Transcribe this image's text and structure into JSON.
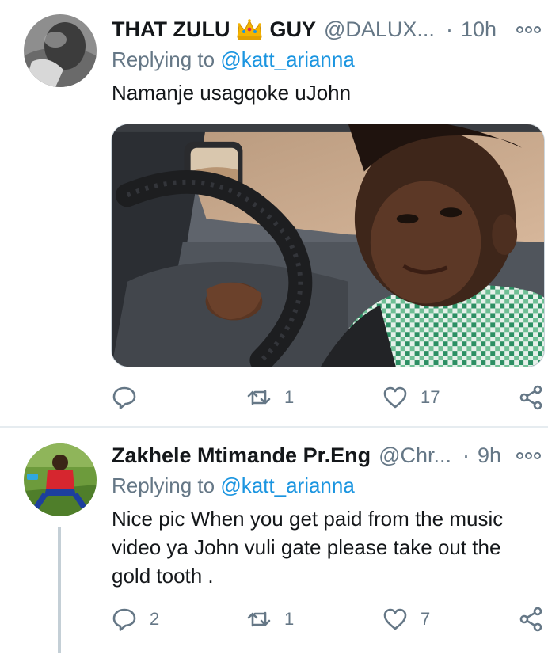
{
  "tweets": [
    {
      "name_part1": "THAT ZULU",
      "name_part2": "GUY",
      "name_emoji": "crown-icon",
      "handle": "@DALUX...",
      "dot": "·",
      "time": "10h",
      "replying_prefix": "Replying to",
      "replying_to": "@katt_arianna",
      "text": "Namanje usagqoke uJohn",
      "has_media": true,
      "counts": {
        "reply": "",
        "retweet": "1",
        "like": "17"
      }
    },
    {
      "name": "Zakhele Mtimande Pr.Eng",
      "handle": "@Chr...",
      "dot": "·",
      "time": "9h",
      "replying_prefix": "Replying to",
      "replying_to": "@katt_arianna",
      "text": "Nice pic When you get paid from the music video ya John vuli gate please take out the gold tooth .",
      "has_media": false,
      "counts": {
        "reply": "2",
        "retweet": "1",
        "like": "7"
      }
    }
  ],
  "colors": {
    "text": "#14171a",
    "secondary": "#657786",
    "link": "#1b95e0",
    "divider": "#e6ecf0",
    "thread_line": "#c4cfd6"
  },
  "icons": {
    "reply": "reply-icon",
    "retweet": "retweet-icon",
    "like": "heart-icon",
    "share": "share-icon",
    "more": "more-options-icon"
  }
}
